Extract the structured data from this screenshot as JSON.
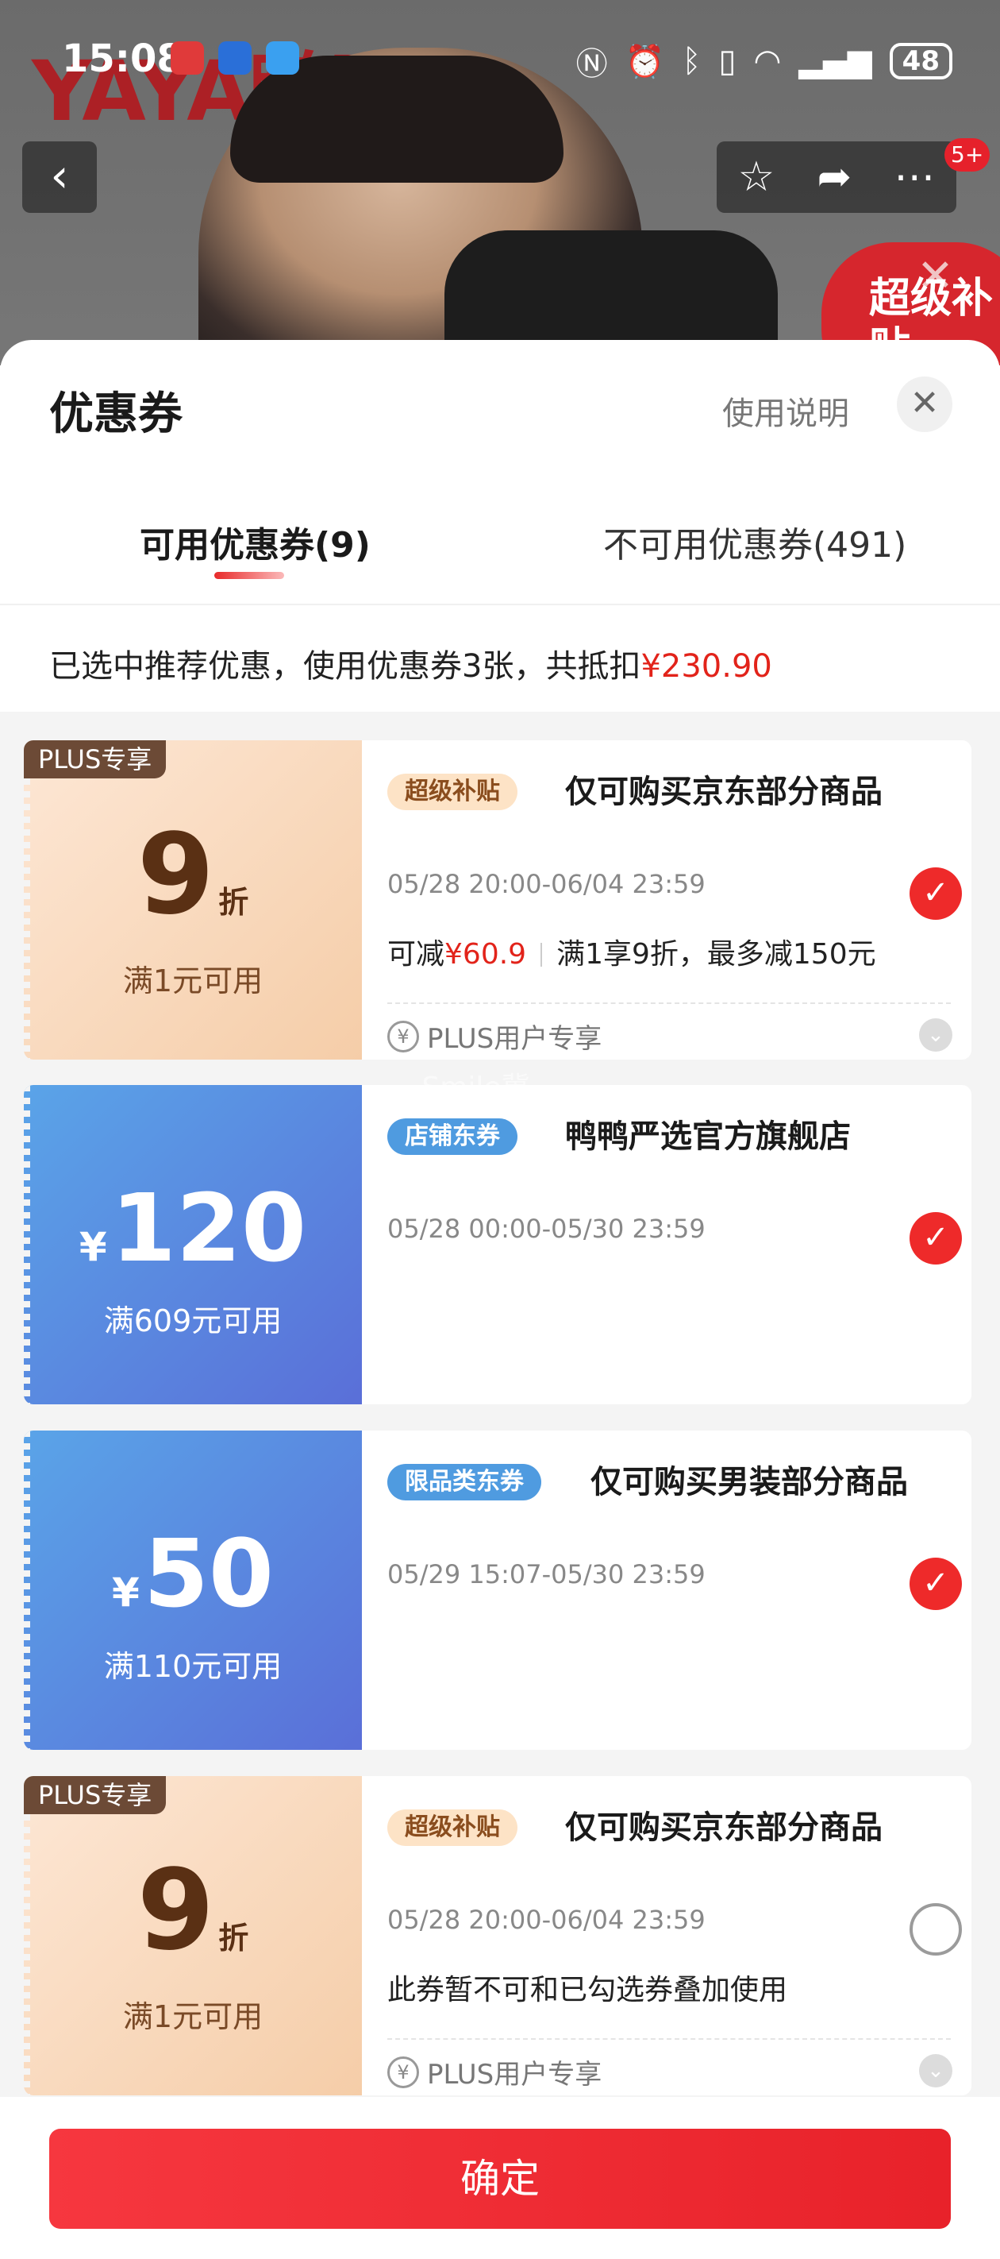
{
  "status": {
    "time": "15:08",
    "battery": "48"
  },
  "background": {
    "brand": "YAYA鸭鸭",
    "promo_badge": "超级补贴"
  },
  "nav": {
    "badge": "5+"
  },
  "sheet": {
    "title": "优惠券",
    "help": "使用说明",
    "tabs": [
      {
        "label": "可用优惠券(9)",
        "active": true
      },
      {
        "label": "不可用优惠券(491)",
        "active": false
      }
    ],
    "summary_text": "已选中推荐优惠，使用优惠券3张，共抵扣",
    "summary_amount": "¥230.90"
  },
  "coupons": [
    {
      "left_tag": "PLUS专享",
      "value": "9",
      "unit": "折",
      "condition": "满1元可用",
      "tag": "超级补贴",
      "title": "仅可购买京东部分商品",
      "date": "05/28 20:00-06/04 23:59",
      "desc_prefix": "可减",
      "desc_amount": "¥60.9",
      "desc_rest": "满1享9折，最多减150元",
      "footer": "PLUS用户专享",
      "checked": true
    },
    {
      "value_prefix": "¥",
      "value": "120",
      "condition": "满609元可用",
      "tag": "店铺东券",
      "title": "鸭鸭严选官方旗舰店",
      "date": "05/28 00:00-05/30 23:59",
      "checked": true
    },
    {
      "value_prefix": "¥",
      "value": "50",
      "condition": "满110元可用",
      "tag": "限品类东券",
      "title": "仅可购买男装部分商品",
      "date": "05/29 15:07-05/30 23:59",
      "checked": true
    },
    {
      "left_tag": "PLUS专享",
      "value": "9",
      "unit": "折",
      "condition": "满1元可用",
      "tag": "超级补贴",
      "title": "仅可购买京东部分商品",
      "date": "05/28 20:00-06/04 23:59",
      "desc_plain": "此券暂不可和已勾选券叠加使用",
      "footer": "PLUS用户专享",
      "checked": false
    }
  ],
  "watermark": ".Smile冀",
  "confirm_label": "确定",
  "icons": {
    "back": "chevron-left-icon",
    "star": "star-icon",
    "share": "share-icon",
    "more": "more-icon",
    "close": "close-icon",
    "check": "check-icon",
    "yen": "yen-circle-icon",
    "expand": "chevron-down-icon"
  }
}
